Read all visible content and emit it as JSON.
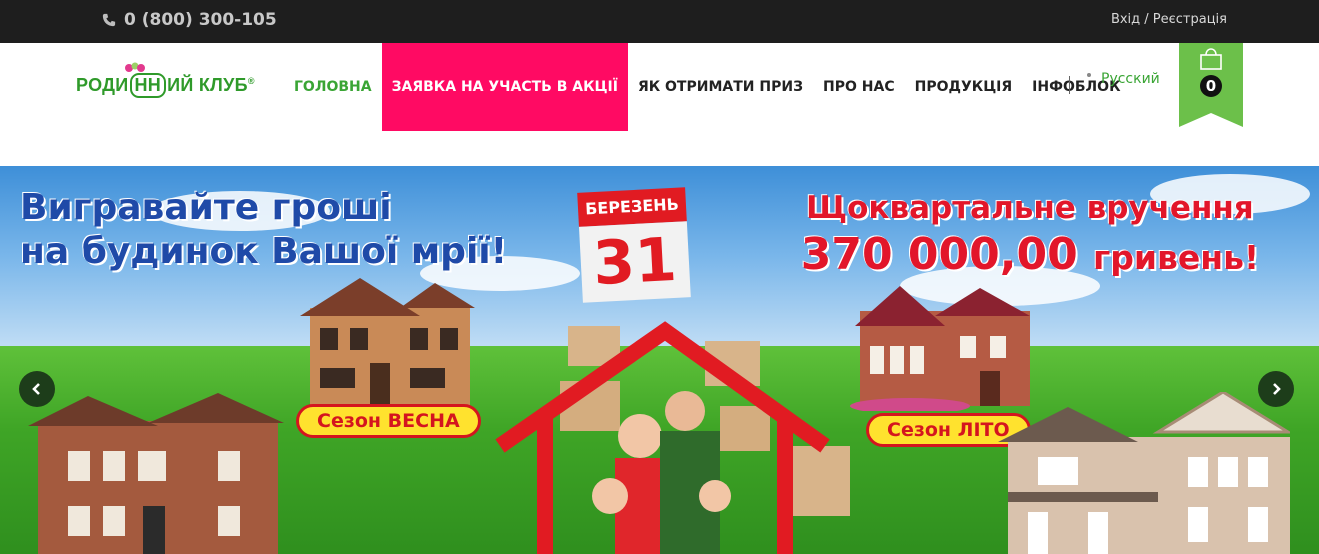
{
  "topbar": {
    "phone": "0 (800) 300-105",
    "login": "Вхід / Реєстрація"
  },
  "logo": {
    "part1": "РОДИ",
    "part2": "НН",
    "part3": "ИЙ КЛУБ",
    "reg": "®"
  },
  "nav": {
    "items": [
      {
        "label": "ГОЛОВНА"
      },
      {
        "label": "ЗАЯВКА НА УЧАСТЬ В АКЦІЇ"
      },
      {
        "label": "ЯК ОТРИМАТИ ПРИЗ"
      },
      {
        "label": "ПРО НАС"
      },
      {
        "label": "ПРОДУКЦІЯ"
      },
      {
        "label": "ІНФОБЛОК"
      }
    ],
    "language": "Русский"
  },
  "cart": {
    "count": "0"
  },
  "banner": {
    "left_line1": "Вигравайте гроші",
    "left_line2": "на будинок Вашої мрії!",
    "calendar_month": "БЕРЕЗЕНЬ",
    "calendar_day": "31",
    "right_line1": "Щоквартальне вручення",
    "right_amount": "370 000,00",
    "right_currency": "гривень!",
    "season_spring": "Сезон ВЕСНА",
    "season_summer": "Сезон ЛІТО"
  },
  "colors": {
    "accent_green": "#3aa535",
    "promo_pink": "#ff0a63",
    "topbar_bg": "#1e1e1e",
    "headline_blue": "#1f4aa8",
    "headline_red": "#e2162a"
  },
  "icons": [
    "phone-icon",
    "shopping-bag-icon",
    "chevron-left-icon",
    "chevron-right-icon"
  ]
}
